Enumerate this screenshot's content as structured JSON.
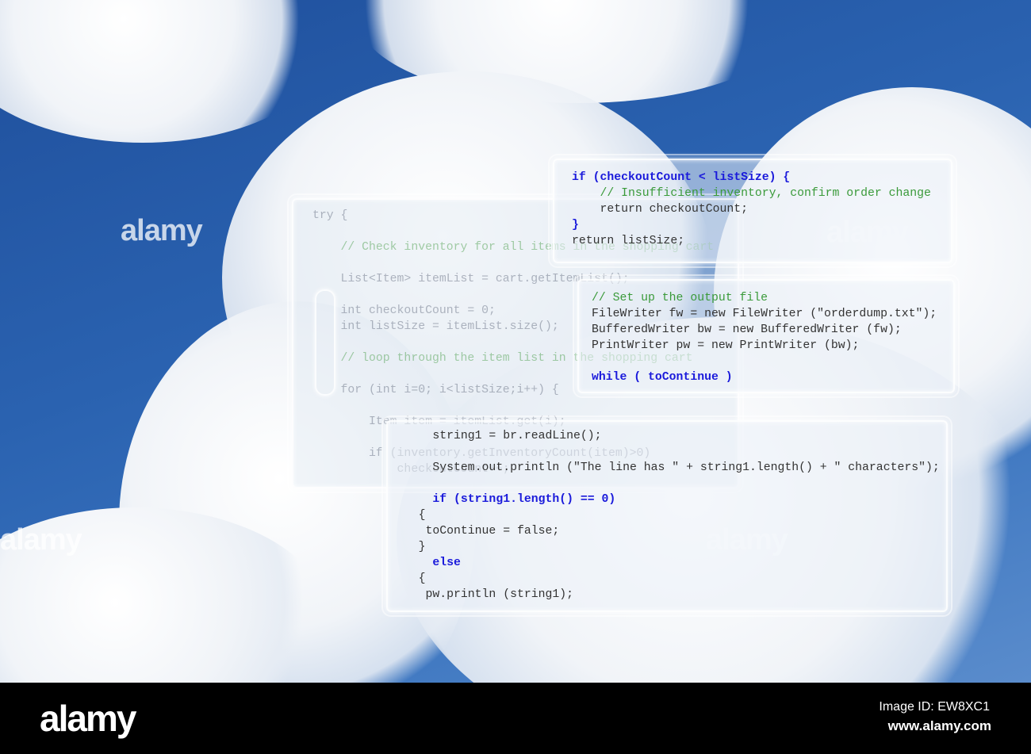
{
  "watermark": "alamy",
  "footer": {
    "logo": "alamy",
    "image_id": "Image ID: EW8XC1",
    "site": "www.alamy.com"
  },
  "panels": {
    "background": {
      "lines": [
        "try {",
        "",
        "    // Check inventory for all items in the shopping cart",
        "",
        "    List<Item> itemList = cart.getItemList();",
        "",
        "    int checkoutCount = 0;",
        "    int listSize = itemList.size();",
        "",
        "    // loop through the item list in the shopping cart",
        "",
        "    for (int i=0; i<listSize;i++) {",
        "",
        "        Item item = itemList.get(i);",
        "",
        "        if (inventory.getInventoryCount(item)>0)",
        "            checkoutCount++;"
      ]
    },
    "top": {
      "l1": "if (checkoutCount < listSize) {",
      "l2": "    // Insufficient inventory, confirm order change",
      "l3": "    return checkoutCount;",
      "l4": "}",
      "l5": "return listSize;"
    },
    "middle": {
      "l1": "// Set up the output file",
      "l2": "FileWriter fw = new FileWriter (\"orderdump.txt\");",
      "l3": "BufferedWriter bw = new BufferedWriter (fw);",
      "l4": "PrintWriter pw = new PrintWriter (bw);",
      "l5": "while ( toContinue )"
    },
    "bottom": {
      "l1": "     string1 = br.readLine();",
      "l2": "     System.out.println (\"The line has \" + string1.length() + \" characters\");",
      "l3": "     if (string1.length() == 0)",
      "l4": "   {",
      "l5": "    toContinue = false;",
      "l6": "   }",
      "l7": "     else",
      "l8": "   {",
      "l9": "    pw.println (string1);"
    }
  }
}
